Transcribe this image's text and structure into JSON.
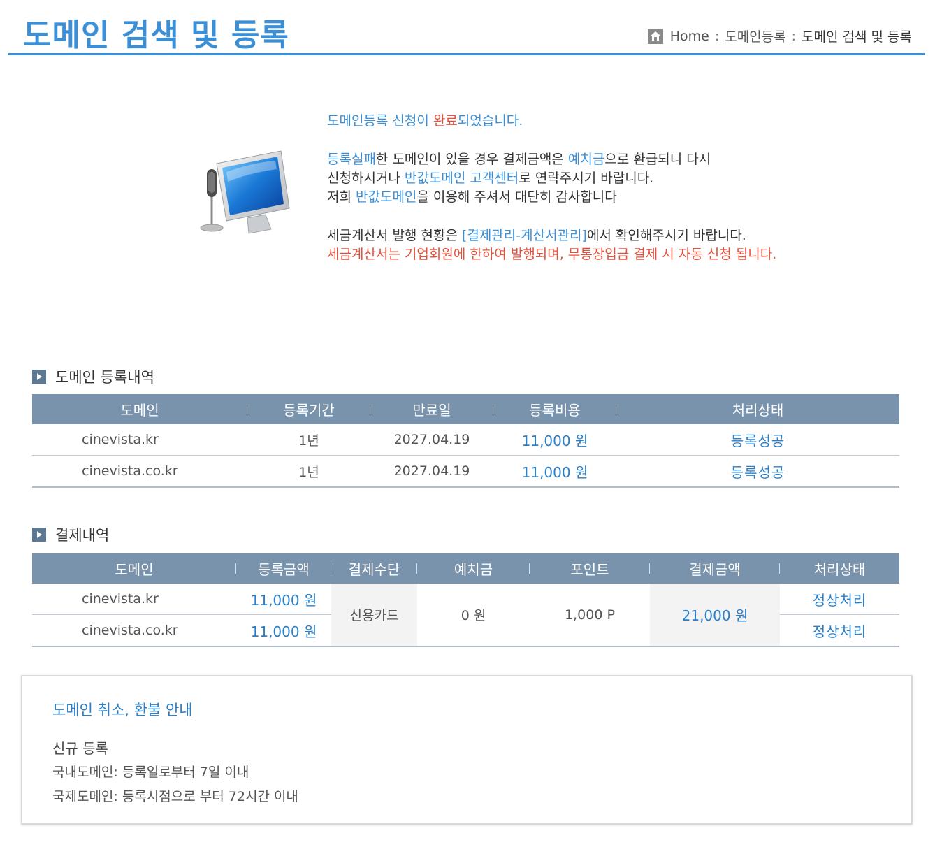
{
  "header": {
    "title": "도메인 검색 및 등록",
    "breadcrumb": [
      "Home",
      "도메인등록",
      "도메인 검색 및 등록"
    ],
    "breadcrumb_sep": ":"
  },
  "notice": {
    "l1_a": "도메인등록 신청이 ",
    "l1_b": "완료",
    "l1_c": "되었습니다.",
    "l2_a": "등록실패",
    "l2_b": "한 도메인이 있을 경우 결제금액은 ",
    "l2_c": "예치금",
    "l2_d": "으로 환급되니 다시",
    "l3_a": "신청하시거나 ",
    "l3_b": "반값도메인 고객센터",
    "l3_c": "로 연락주시기 바랍니다.",
    "l4_a": "저희 ",
    "l4_b": "반값도메인",
    "l4_c": "을 이용해 주셔서 대단히 감사합니다",
    "l5_a": "세금계산서 발행 현황은 ",
    "l5_b": "[결제관리-계산서관리]",
    "l5_c": "에서 확인해주시기 바랍니다.",
    "l6": "세금계산서는 기업회원에 한하여 발행되며, 무통장입금 결제 시 자동 신청 됩니다."
  },
  "registration": {
    "title": "도메인 등록내역",
    "headers": [
      "도메인",
      "등록기간",
      "만료일",
      "등록비용",
      "처리상태"
    ],
    "rows": [
      {
        "domain": "cinevista.kr",
        "period": "1년",
        "expiry": "2027.04.19",
        "cost": "11,000 원",
        "status": "등록성공"
      },
      {
        "domain": "cinevista.co.kr",
        "period": "1년",
        "expiry": "2027.04.19",
        "cost": "11,000 원",
        "status": "등록성공"
      }
    ]
  },
  "payment": {
    "title": "결제내역",
    "headers": [
      "도메인",
      "등록금액",
      "결제수단",
      "예치금",
      "포인트",
      "결제금액",
      "처리상태"
    ],
    "rows": [
      {
        "domain": "cinevista.kr",
        "amount": "11,000 원",
        "status": "정상처리"
      },
      {
        "domain": "cinevista.co.kr",
        "amount": "11,000 원",
        "status": "정상처리"
      }
    ],
    "method": "신용카드",
    "deposit": "0 원",
    "point": "1,000 P",
    "total": "21,000 원"
  },
  "guide": {
    "title": "도메인 취소, 환불 안내",
    "subtitle": "신규 등록",
    "lines": [
      "국내도메인: 등록일로부터 7일 이내",
      "국제도메인: 등록시점으로 부터 72시간 이내"
    ]
  },
  "colors": {
    "accent": "#3a8fd6",
    "alert": "#e6503c",
    "table_header": "#7a93ac"
  }
}
